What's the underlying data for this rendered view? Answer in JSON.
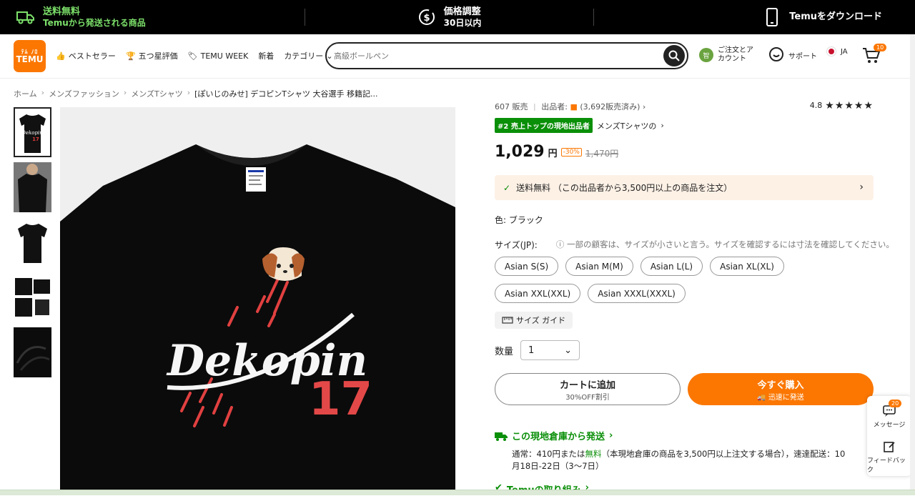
{
  "topbar": {
    "free_shipping_title": "送料無料",
    "free_shipping_sub": "Temuから発送される商品",
    "price_adjust_title": "価格調整",
    "price_adjust_sub": "30日以内",
    "download": "Temuをダウンロード"
  },
  "header": {
    "logo_top": "ﾃﾑ ﾉﾛ",
    "logo_main": "TEMU",
    "nav": [
      "ベストセラー",
      "五つ星評価",
      "TEMU WEEK",
      "新着",
      "カテゴリー"
    ],
    "search_placeholder": "高級ボールペン",
    "account_avatar": "智",
    "account_line1": "ご注文とア",
    "account_line2": "カウント",
    "support": "サポート",
    "lang": "JA",
    "cart_count": "10"
  },
  "breadcrumb": [
    "ホーム",
    "メンズファッション",
    "メンズTシャツ",
    "[ぽいじのみせ] デコピンTシャツ 大谷選手 移籍記..."
  ],
  "product": {
    "sales": "607 販売",
    "seller_label": "出品者:",
    "seller_sales": "(3,692販売済み)",
    "rating": "4.8",
    "rank_badge": "#2 売上トップの現地出品者",
    "rank_category": "メンズTシャツの",
    "price": "1,029",
    "price_unit": "円",
    "discount": "-30%",
    "old_price": "1,470円",
    "shipping": "送料無料 （この出品者から3,500円以上の商品を注文）",
    "color_label": "色: ブラック",
    "size_label": "サイズ(JP):",
    "size_note": "ⓘ 一部の顧客は、サイズが小さいと言う。サイズを確認するには寸法を確認してください。",
    "sizes": [
      "Asian S(S)",
      "Asian M(M)",
      "Asian L(L)",
      "Asian XL(XL)",
      "Asian XXL(XXL)",
      "Asian XXXL(XXXL)"
    ],
    "size_guide": "サイズ ガイド",
    "qty_label": "数量",
    "qty_value": "1",
    "add_cart": "カートに追加",
    "add_cart_sub": "30%OFF割引",
    "buy_now": "今すぐ購入",
    "buy_now_sub": "迅速に発送",
    "warehouse_title": "この現地倉庫から発送",
    "warehouse_text_1": "通常：410円または",
    "warehouse_text_free": "無料",
    "warehouse_text_2": "（本現地倉庫の商品を3,500円以上注文する場合），速達配送：10",
    "warehouse_text_3": "月18日-22日（3〜7日）",
    "temu_initiative": "Temuの取り組み",
    "shirt_word": "Dekopin",
    "shirt_number": "17"
  },
  "sidepanel": {
    "message_badge": "20",
    "message": "メッセージ",
    "feedback": "フィードバック"
  },
  "colors": {
    "accent": "#fb7701",
    "green": "#0a8f08",
    "topbar_green": "#7ce06a"
  }
}
